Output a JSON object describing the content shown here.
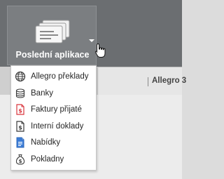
{
  "ribbon": {
    "app_button": {
      "label": "Poslední aplikace",
      "icon": "stacked-cards-icon",
      "dropdown_icon": "caret-down-icon"
    }
  },
  "tabs": {
    "active_label": "Allegro 3"
  },
  "menu": {
    "items": [
      {
        "label": "Allegro překlady",
        "icon": "globe-icon"
      },
      {
        "label": "Banky",
        "icon": "coin-stack-icon"
      },
      {
        "label": "Faktury přijaté",
        "icon": "invoice-icon"
      },
      {
        "label": "Interní doklady",
        "icon": "internal-document-icon"
      },
      {
        "label": "Nabídky",
        "icon": "offer-document-icon"
      },
      {
        "label": "Pokladny",
        "icon": "money-bag-icon"
      }
    ]
  },
  "colors": {
    "ribbon_bg": "#6b6e71",
    "button_bg": "#7b7e81",
    "invoice_red": "#d9363e",
    "offer_blue": "#3b7dd8"
  }
}
